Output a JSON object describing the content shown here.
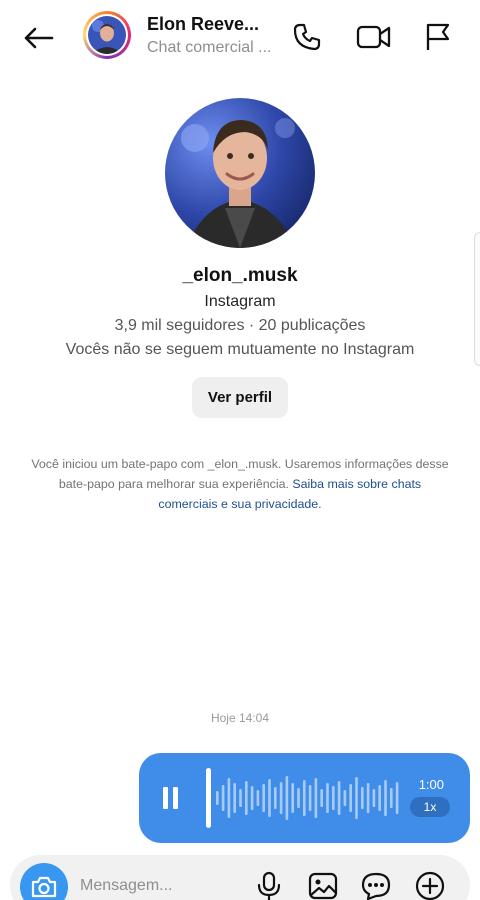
{
  "header": {
    "name": "Elon Reeve...",
    "subtitle": "Chat comercial ...",
    "icons": [
      "back-arrow-icon",
      "phone-icon",
      "video-icon",
      "flag-icon"
    ]
  },
  "profile": {
    "username": "_elon_.musk",
    "platform": "Instagram",
    "stats": "3,9 mil seguidores · 20 publicações",
    "mutual": "Vocês não se seguem mutuamente no Instagram",
    "view_profile": "Ver perfil"
  },
  "notice": {
    "text": "Você iniciou um bate-papo com _elon_.musk. Usaremos informações desse bate-papo para melhorar sua experiência. ",
    "link": "Saiba mais sobre chats comerciais e sua privacidade."
  },
  "timestamp": "Hoje 14:04",
  "voice_message": {
    "duration": "1:00",
    "speed": "1x",
    "color": "#3f8de8",
    "state": "playing"
  },
  "composer": {
    "placeholder": "Mensagem...",
    "icons": [
      "camera-icon",
      "microphone-icon",
      "image-icon",
      "sticker-icon",
      "plus-icon"
    ]
  },
  "colors": {
    "accent": "#3897f0",
    "link": "#1f4f8f"
  }
}
